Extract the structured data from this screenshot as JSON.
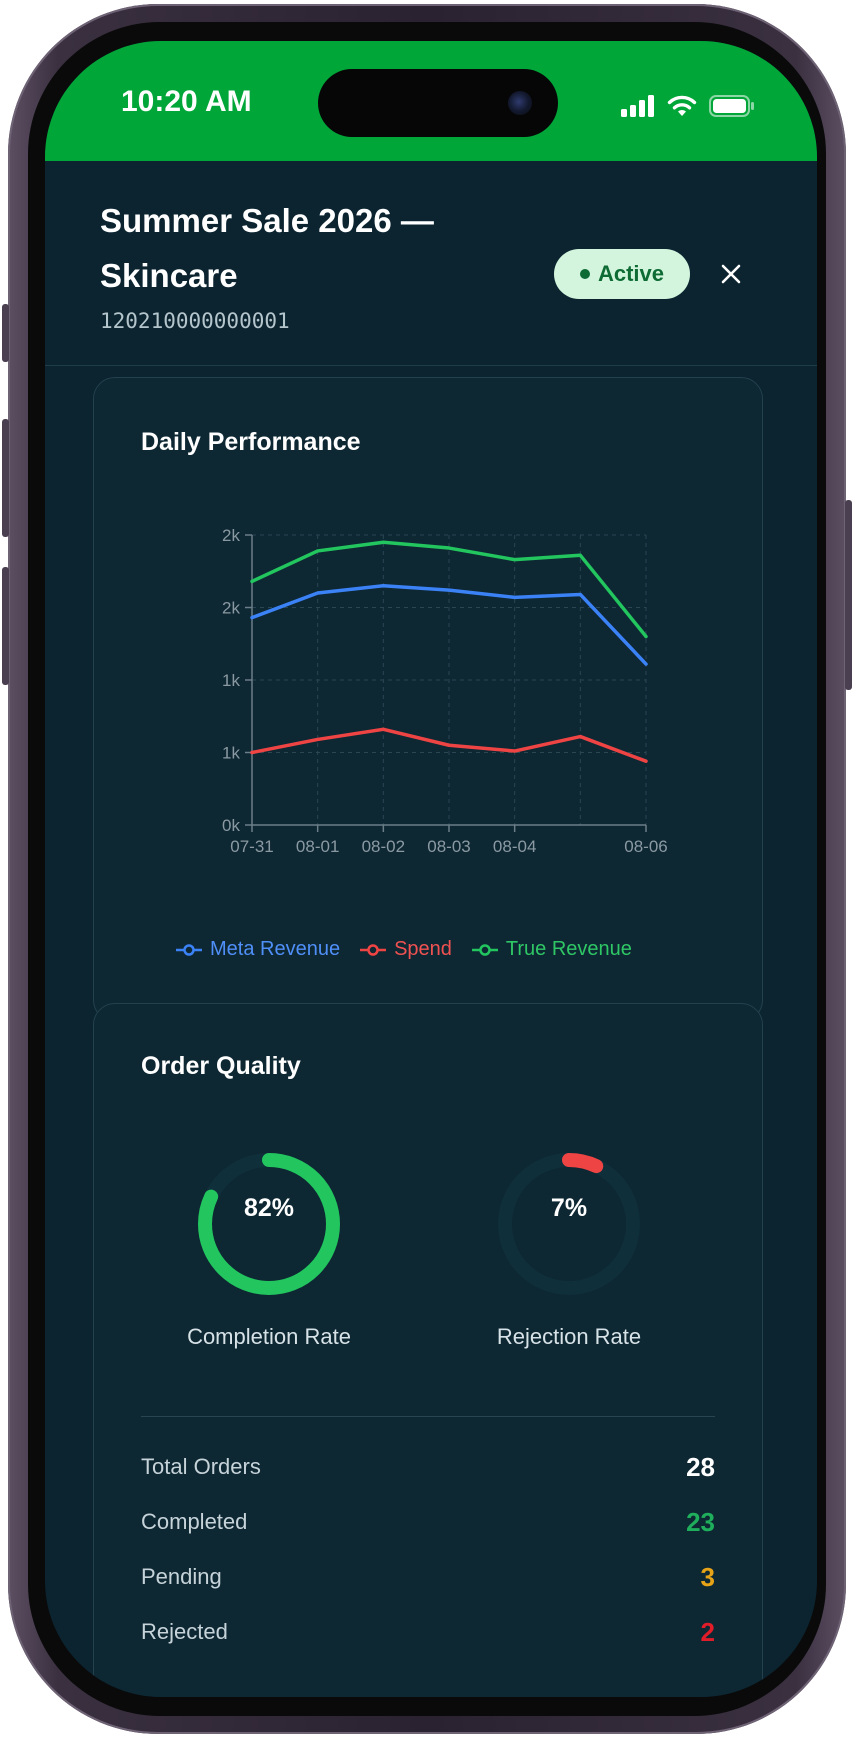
{
  "status_bar": {
    "time": "10:20 AM"
  },
  "header": {
    "title": "Summer Sale 2026 — Skincare",
    "campaign_id": "120210000000001",
    "status_badge": "Active",
    "close_icon": "close-icon"
  },
  "daily_performance": {
    "title": "Daily Performance",
    "y_tick_labels": [
      "0k",
      "1k",
      "1k",
      "2k",
      "2k"
    ],
    "x_tick_labels": [
      "07-31",
      "08-01",
      "08-02",
      "08-03",
      "08-04",
      "08-06"
    ],
    "legend": {
      "meta_revenue": "Meta Revenue",
      "spend": "Spend",
      "true_revenue": "True Revenue"
    }
  },
  "chart_data": {
    "type": "line",
    "title": "Daily Performance",
    "xlabel": "",
    "ylabel": "",
    "x": [
      "07-31",
      "08-01",
      "08-02",
      "08-03",
      "08-04",
      "08-05",
      "08-06"
    ],
    "x_tick_labels_shown": [
      "07-31",
      "08-01",
      "08-02",
      "08-03",
      "08-04",
      "08-06"
    ],
    "ylim": [
      0,
      2000
    ],
    "y_tick_labels": [
      "0k",
      "1k",
      "1k",
      "2k",
      "2k"
    ],
    "grid": true,
    "legend_position": "bottom",
    "series": [
      {
        "name": "Meta Revenue",
        "color": "#3b82f6",
        "values": [
          1430,
          1600,
          1650,
          1620,
          1570,
          1590,
          1110
        ]
      },
      {
        "name": "Spend",
        "color": "#ef4444",
        "values": [
          500,
          590,
          660,
          550,
          510,
          610,
          440
        ]
      },
      {
        "name": "True Revenue",
        "color": "#22c55e",
        "values": [
          1680,
          1890,
          1950,
          1910,
          1830,
          1860,
          1300
        ]
      }
    ]
  },
  "order_quality": {
    "title": "Order Quality",
    "completion_rate": {
      "label": "Completion Rate",
      "value_text": "82%",
      "value": 0.82,
      "color": "#22c55e"
    },
    "rejection_rate": {
      "label": "Rejection Rate",
      "value_text": "7%",
      "value": 0.07,
      "color": "#ef4444"
    },
    "stats": [
      {
        "label": "Total Orders",
        "value": "28",
        "color": "#ffffff"
      },
      {
        "label": "Completed",
        "value": "23",
        "color": "#1fae5b"
      },
      {
        "label": "Pending",
        "value": "3",
        "color": "#e6a317"
      },
      {
        "label": "Rejected",
        "value": "2",
        "color": "#e11d2a"
      }
    ]
  }
}
